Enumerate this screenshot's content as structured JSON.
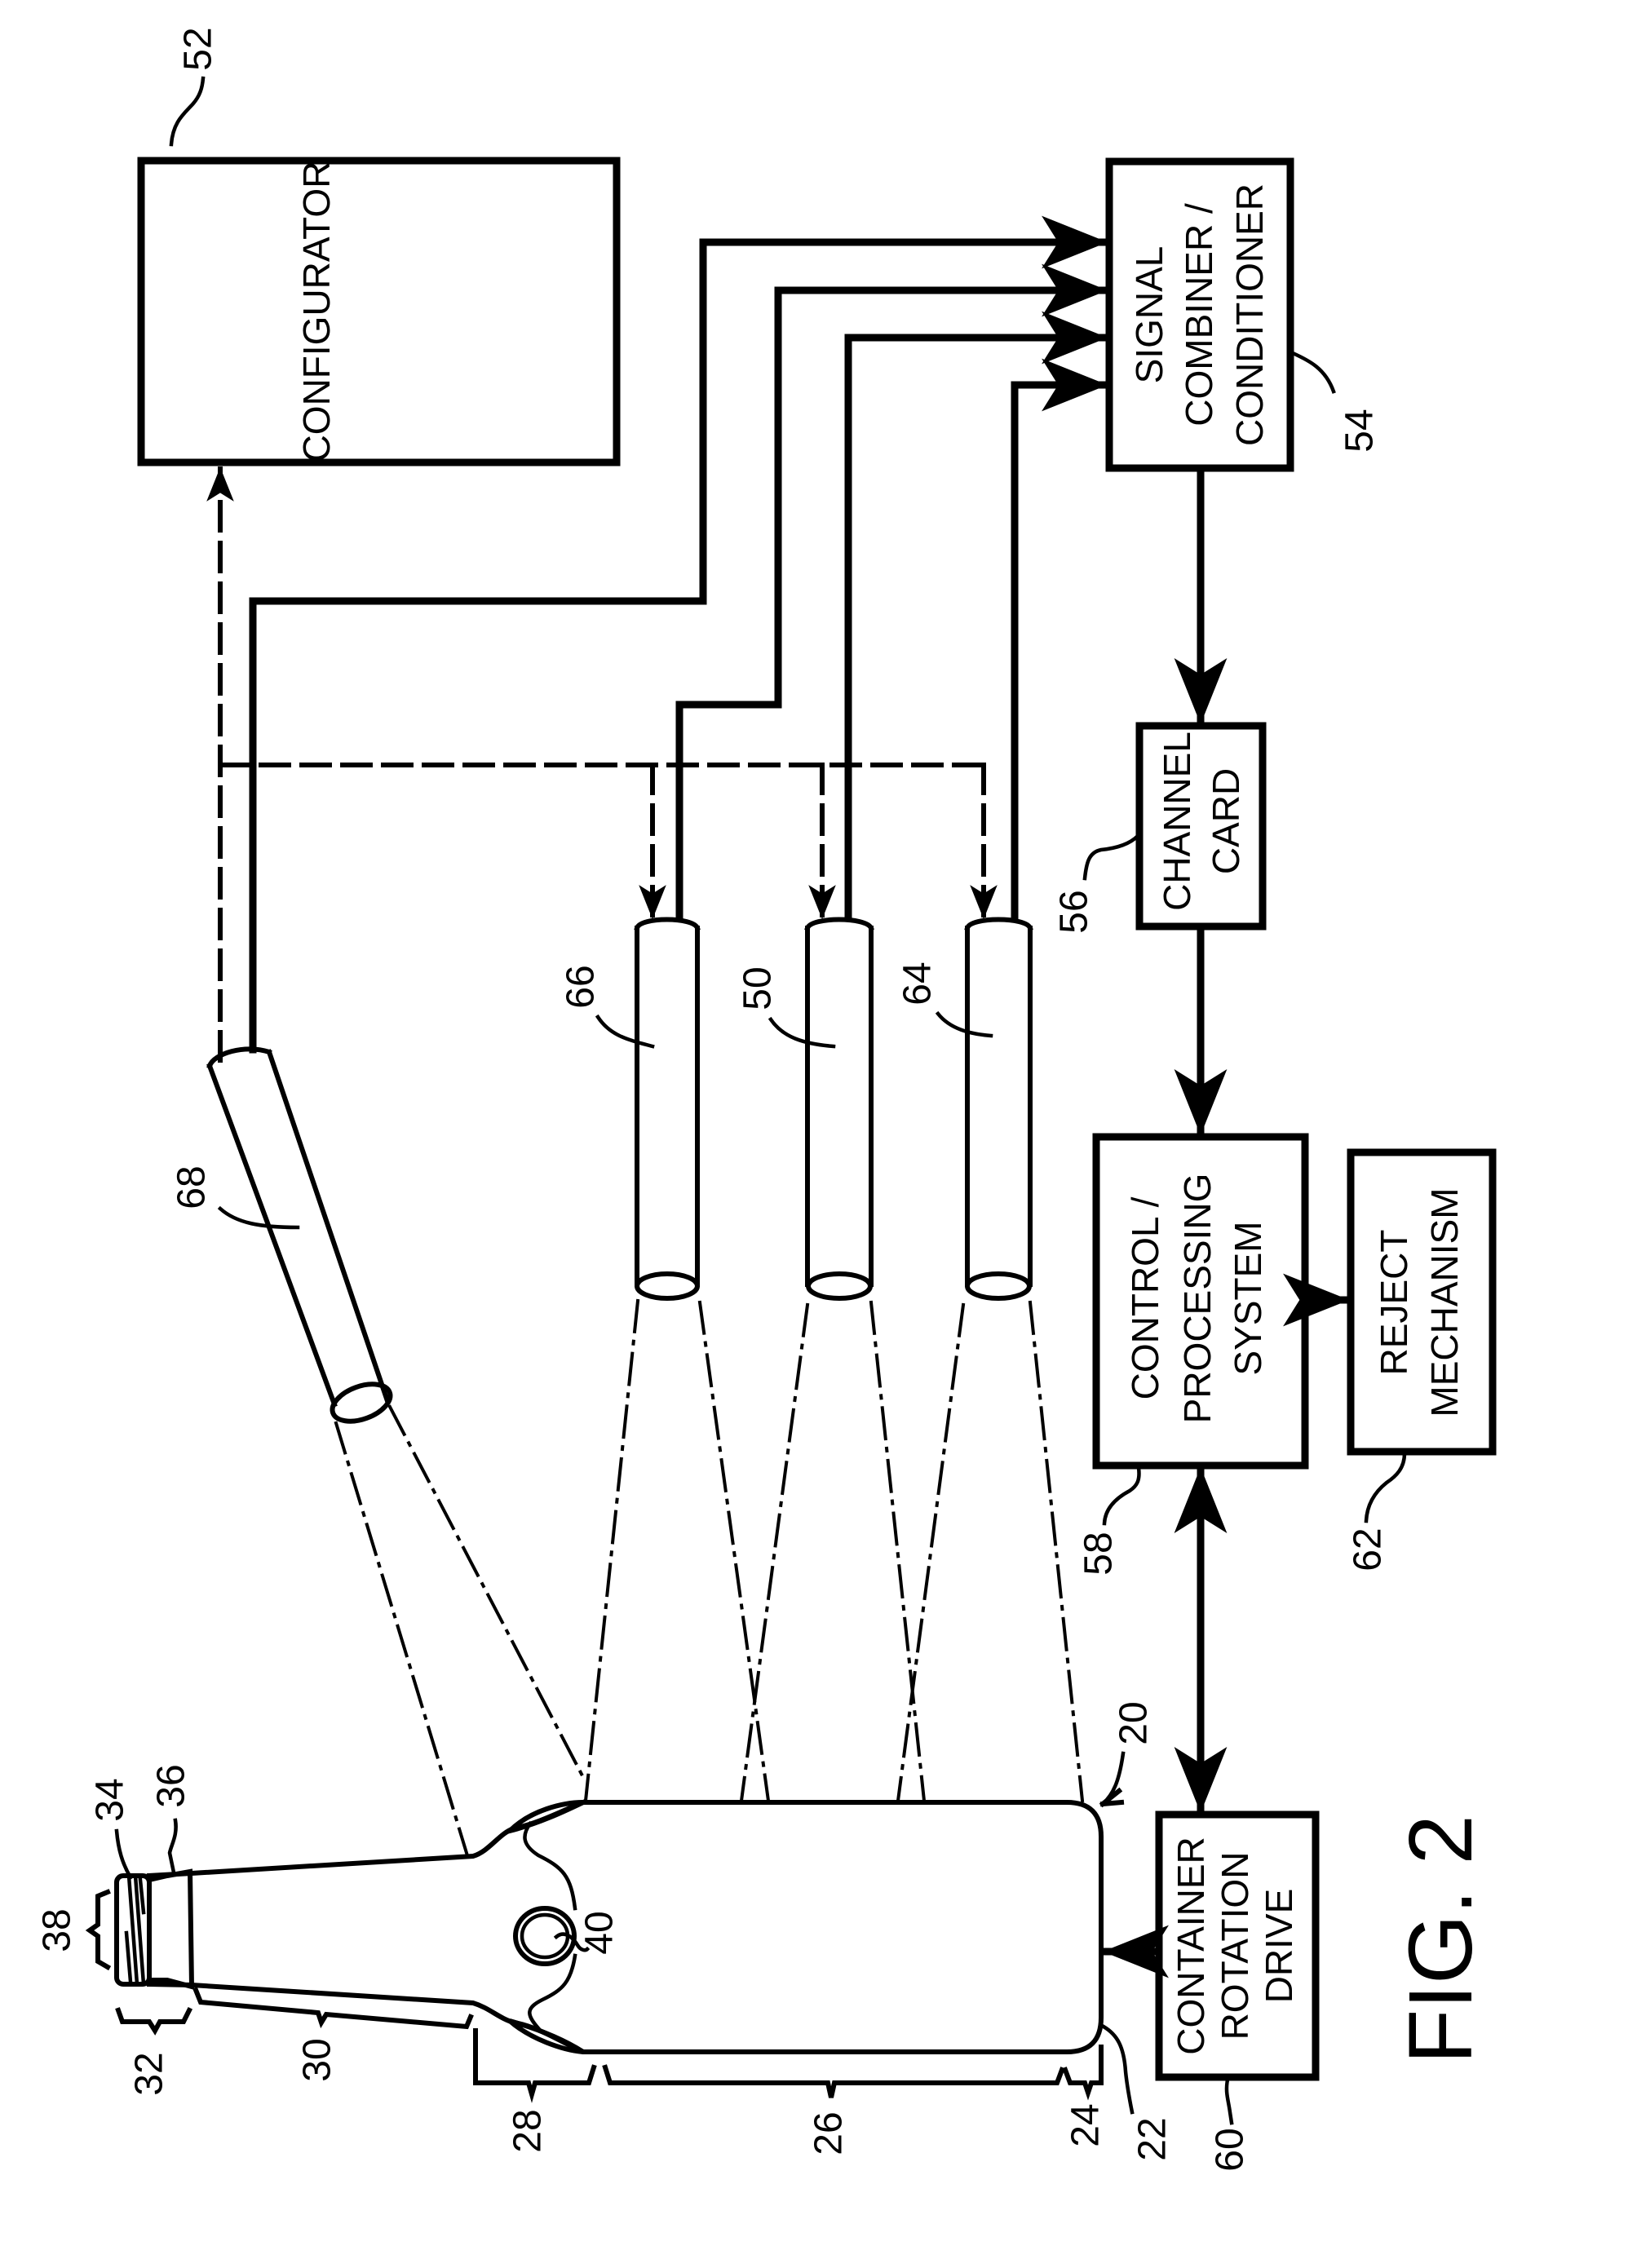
{
  "figure": {
    "title": "FIG. 2",
    "orientation": "rotated 90 degrees counter-clockwise"
  },
  "blocks": {
    "configurator": {
      "ref": "52",
      "lines": [
        "CONFIGURATOR"
      ]
    },
    "signal_combiner": {
      "ref": "54",
      "lines": [
        "SIGNAL",
        "COMBINER /",
        "CONDITIONER"
      ]
    },
    "channel_card": {
      "ref": "56",
      "lines": [
        "CHANNEL",
        "CARD"
      ]
    },
    "control_processing": {
      "ref": "58",
      "lines": [
        "CONTROL /",
        "PROCESSING",
        "SYSTEM"
      ]
    },
    "container_rotation_drive": {
      "ref": "60",
      "lines": [
        "CONTAINER",
        "ROTATION",
        "DRIVE"
      ]
    },
    "reject_mechanism": {
      "ref": "62",
      "lines": [
        "REJECT",
        "MECHANISM"
      ]
    }
  },
  "sensors": [
    {
      "ref": "68"
    },
    {
      "ref": "66"
    },
    {
      "ref": "50"
    },
    {
      "ref": "64"
    }
  ],
  "container": {
    "ref": "20",
    "bottom_ref": "22",
    "regions": {
      "heel": "24",
      "body": "26",
      "shoulder": "28",
      "neck": "30",
      "finish": "32",
      "thread": "34",
      "neck_ring": "36",
      "threads_region": "38",
      "marks": "40"
    }
  }
}
